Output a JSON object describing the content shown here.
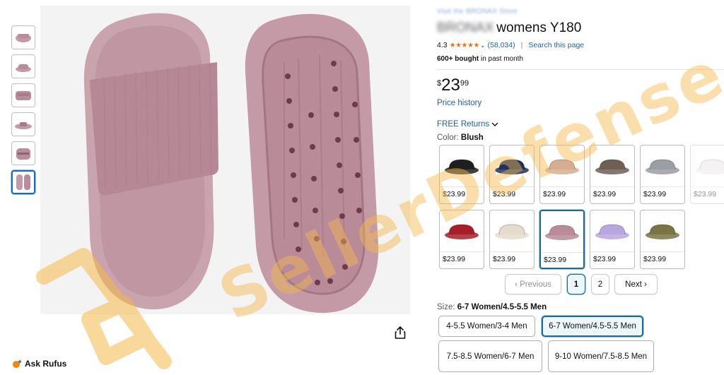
{
  "store_link": "Visit the BRONAX Store",
  "product": {
    "brand": "BRONAX",
    "title": "womens Y180"
  },
  "rating": {
    "value": "4.3",
    "stars": "★★★★★",
    "count": "(58,034)",
    "search_link": "Search this page"
  },
  "bought": {
    "bold": "600+ bought",
    "rest": " in past month"
  },
  "price": {
    "symbol": "$",
    "whole": "23",
    "fraction": "99"
  },
  "price_history": "Price history",
  "returns": "FREE Returns",
  "color": {
    "label": "Color:",
    "selected": "Blush",
    "swatches": [
      {
        "name": "Black",
        "hex": "#1f1f1f",
        "price": "$23.99"
      },
      {
        "name": "Navy",
        "hex": "#1f2f5e",
        "price": "$23.99"
      },
      {
        "name": "Beige",
        "hex": "#d7ad92",
        "price": "$23.99"
      },
      {
        "name": "Brown",
        "hex": "#6e5f55",
        "price": "$23.99"
      },
      {
        "name": "Grey",
        "hex": "#9b9ea3",
        "price": "$23.99"
      },
      {
        "name": "White",
        "hex": "#e8e4e3",
        "price": "$23.99"
      },
      {
        "name": "Red",
        "hex": "#a81d2b",
        "price": "$23.99"
      },
      {
        "name": "Cream",
        "hex": "#e6dccd",
        "price": "$23.99"
      },
      {
        "name": "Blush",
        "hex": "#b98a98",
        "price": "$23.99"
      },
      {
        "name": "Lavender",
        "hex": "#b8a6e0",
        "price": "$23.99"
      },
      {
        "name": "Olive",
        "hex": "#7a7343",
        "price": "$23.99"
      }
    ]
  },
  "pager": {
    "previous": "‹ Previous",
    "page1": "1",
    "page2": "2",
    "next": "Next ›"
  },
  "size": {
    "label": "Size:",
    "selected": "6-7 Women/4.5-5.5 Men",
    "options": [
      "4-5.5 Women/3-4 Men",
      "6-7 Women/4.5-5.5 Men",
      "7.5-8.5 Women/6-7 Men",
      "9-10 Women/7.5-8.5 Men"
    ]
  },
  "ask_rufus": "Ask Rufus",
  "watermark": "SellerDefense",
  "colors": {
    "link": "#2162a1",
    "star": "#de7921",
    "selected_border": "#1b6a96",
    "product_blush": "#c39aa5",
    "watermark": "#f5b94a"
  },
  "icons": [
    "share-icon",
    "rufus-icon",
    "chevron-down-icon",
    "star-icon"
  ]
}
